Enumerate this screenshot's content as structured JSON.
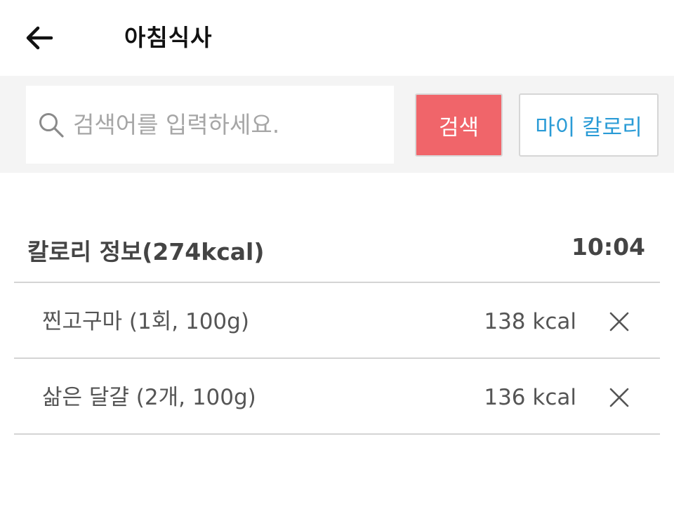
{
  "header": {
    "title": "아침식사",
    "back_icon": "arrow-left-icon"
  },
  "search": {
    "placeholder": "검색어를 입력하세요.",
    "value": "",
    "search_icon": "search-icon",
    "search_button_label": "검색",
    "my_calorie_button_label": "마이 칼로리"
  },
  "summary": {
    "title": "칼로리 정보(274kcal)",
    "time": "10:04"
  },
  "items": [
    {
      "name": "찐고구마 (1회, 100g)",
      "kcal": "138 kcal"
    },
    {
      "name": "삶은 달걀 (2개, 100g)",
      "kcal": "136 kcal"
    }
  ],
  "colors": {
    "accent_red": "#f0656a",
    "accent_blue": "#2a9bd6",
    "search_bar_bg": "#f4f4f4"
  }
}
